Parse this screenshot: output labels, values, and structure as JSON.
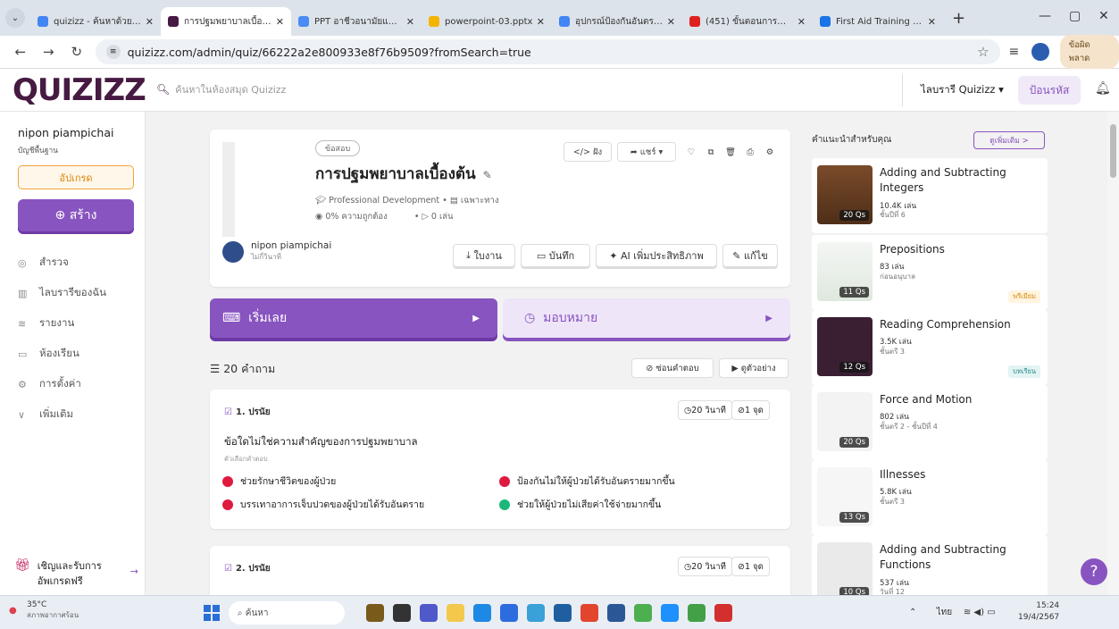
{
  "browser": {
    "tabs": [
      {
        "title": "quizizz - ค้นหาด้วย Go",
        "fav": "#4285f4",
        "active": false
      },
      {
        "title": "การปฐมพยาบาลเบื้องต้น",
        "fav": "#461a42",
        "active": true
      },
      {
        "title": "PPT อาชีวอนามัยและความ",
        "fav": "#4c8bf5",
        "active": false
      },
      {
        "title": "powerpoint-03.pptx",
        "fav": "#f4b400",
        "active": false
      },
      {
        "title": "อุปกรณ์ป้องกันอันตราย",
        "fav": "#4285f4",
        "active": false
      },
      {
        "title": "(451) ขั้นตอนการทำ CP",
        "fav": "#e02020",
        "active": false
      },
      {
        "title": "First Aid Training Ugar",
        "fav": "#1a73e8",
        "active": false
      }
    ],
    "url": "quizizz.com/admin/quiz/66222a2e800933e8f76b9509?fromSearch=true",
    "error_chip": "ข้อผิดพลาด"
  },
  "header": {
    "logo": "QUIZIZZ",
    "search_placeholder": "ค้นหาในห้องสมุด Quizizz",
    "library": "ไลบรารี Quizizz ▾",
    "enter_code": "ป้อนรหัส"
  },
  "sidebar": {
    "user": "nipon piampichai",
    "account": "บัญชีพื้นฐาน",
    "upgrade": "อัปเกรด",
    "create": "⊕ สร้าง",
    "items": [
      "สำรวจ",
      "ไลบรารีของฉัน",
      "รายงาน",
      "ห้องเรียน",
      "การตั้งค่า",
      "เพิ่มเติม"
    ],
    "invite": "เชิญและรับการอัพเกรดฟรี"
  },
  "quiz": {
    "tag": "ข้อสอบ",
    "title": "การปฐมพยาบาลเบื้องต้น",
    "category": "Professional Development",
    "visibility": "เฉพาะทาง",
    "accuracy": "0% ความถูกต้อง",
    "plays": "0 เล่น",
    "author": "nipon piampichai",
    "author_sub": "ไม่กี่วินาที",
    "embed": "</> ฝัง",
    "share": "➦ แชร์ ▾",
    "worksheet": "ใบงาน",
    "save": "บันทึก",
    "ai_enhance": "AI เพิ่มประสิทธิภาพ",
    "edit": "แก้ไข",
    "start": "เริ่มเลย",
    "assign": "มอบหมาย",
    "question_count": "20 คำถาม",
    "hide_answers": "ซ่อนคำตอบ",
    "preview": "ดูตัวอย่าง"
  },
  "questions": [
    {
      "num": "1. ปรนัย",
      "time": "20 วินาที",
      "points": "1 จุด",
      "text": "ข้อใดไม่ใช่ความสำคัญของการปฐมพยาบาล",
      "sub": "ตัวเลือกคำตอบ",
      "options": [
        {
          "text": "ช่วยรักษาชีวิตของผู้ป่วย",
          "color": "#e0193f"
        },
        {
          "text": "ป้องกันไม่ให้ผู้ป่วยได้รับอันตรายมากขึ้น",
          "color": "#e0193f"
        },
        {
          "text": "บรรเทาอาการเจ็บปวดของผู้ป่วยได้รับอันตราย",
          "color": "#e0193f"
        },
        {
          "text": "ช่วยให้ผู้ป่วยไม่เสียค่าใช้จ่ายมากขึ้น",
          "color": "#1cb77a"
        }
      ]
    },
    {
      "num": "2. ปรนัย",
      "time": "20 วินาที",
      "points": "1 จุด"
    }
  ],
  "recommend": {
    "title": "คำแนะนำสำหรับคุณ",
    "see_more": "ดูเพิ่มเติม >",
    "items": [
      {
        "title": "Adding and Subtracting Integers",
        "plays": "10.4K เล่น",
        "grade": "ชั้นปีที่ 6",
        "qs": "20 Qs",
        "badge": ""
      },
      {
        "title": "Prepositions",
        "plays": "83 เล่น",
        "grade": "ก่อนอนุบาล",
        "qs": "11 Qs",
        "badge": "พรีเมียม"
      },
      {
        "title": "Reading Comprehension",
        "plays": "3.5K เล่น",
        "grade": "ชั้นตรี 3",
        "qs": "12 Qs",
        "badge": "บทเรียน"
      },
      {
        "title": "Force and Motion",
        "plays": "802 เล่น",
        "grade": "ชั้นตรี 2 - ชั้นปีที่ 4",
        "qs": "20 Qs",
        "badge": ""
      },
      {
        "title": "Illnesses",
        "plays": "5.8K เล่น",
        "grade": "ชั้นตรี 3",
        "qs": "13 Qs",
        "badge": ""
      },
      {
        "title": "Adding and Subtracting Functions",
        "plays": "537 เล่น",
        "grade": "วันที่ 12",
        "qs": "10 Qs",
        "badge": ""
      }
    ]
  },
  "taskbar": {
    "temp": "35°C",
    "weather": "สภาพอากาศร้อน",
    "search": "ค้นหา",
    "lang": "ไทย",
    "time": "15:24",
    "date": "19/4/2567"
  }
}
